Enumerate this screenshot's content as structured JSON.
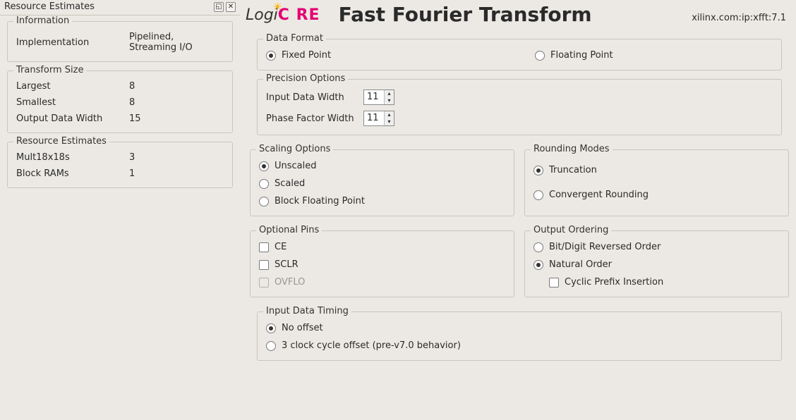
{
  "sidebar": {
    "panel_title": "Resource Estimates",
    "information": {
      "legend": "Information",
      "rows": [
        {
          "label": "Implementation",
          "value": "Pipelined, Streaming I/O"
        }
      ]
    },
    "transform_size": {
      "legend": "Transform Size",
      "rows": [
        {
          "label": "Largest",
          "value": "8"
        },
        {
          "label": "Smallest",
          "value": "8"
        },
        {
          "label": "Output Data Width",
          "value": "15"
        }
      ]
    },
    "resource_estimates": {
      "legend": "Resource Estimates",
      "rows": [
        {
          "label": "Mult18x18s",
          "value": "3"
        },
        {
          "label": "Block RAMs",
          "value": "1"
        }
      ]
    }
  },
  "header": {
    "logo_left": "Logi",
    "logo_right": "C   RE",
    "title": "Fast Fourier Transform",
    "ip_path": "xilinx.com:ip:xfft:7.1"
  },
  "data_format": {
    "legend": "Data Format",
    "fixed": "Fixed Point",
    "floating": "Floating Point"
  },
  "precision": {
    "legend": "Precision Options",
    "input_label": "Input Data Width",
    "input_value": "11",
    "phase_label": "Phase Factor Width",
    "phase_value": "11"
  },
  "scaling": {
    "legend": "Scaling Options",
    "unscaled": "Unscaled",
    "scaled": "Scaled",
    "bfp": "Block Floating Point"
  },
  "rounding": {
    "legend": "Rounding Modes",
    "trunc": "Truncation",
    "conv": "Convergent Rounding"
  },
  "optional_pins": {
    "legend": "Optional Pins",
    "ce": "CE",
    "sclr": "SCLR",
    "ovflo": "OVFLO"
  },
  "output_ordering": {
    "legend": "Output Ordering",
    "reversed": "Bit/Digit Reversed Order",
    "natural": "Natural Order",
    "cyclic": "Cyclic Prefix Insertion"
  },
  "timing": {
    "legend": "Input Data Timing",
    "no_offset": "No offset",
    "offset3": "3 clock cycle offset (pre-v7.0 behavior)"
  }
}
